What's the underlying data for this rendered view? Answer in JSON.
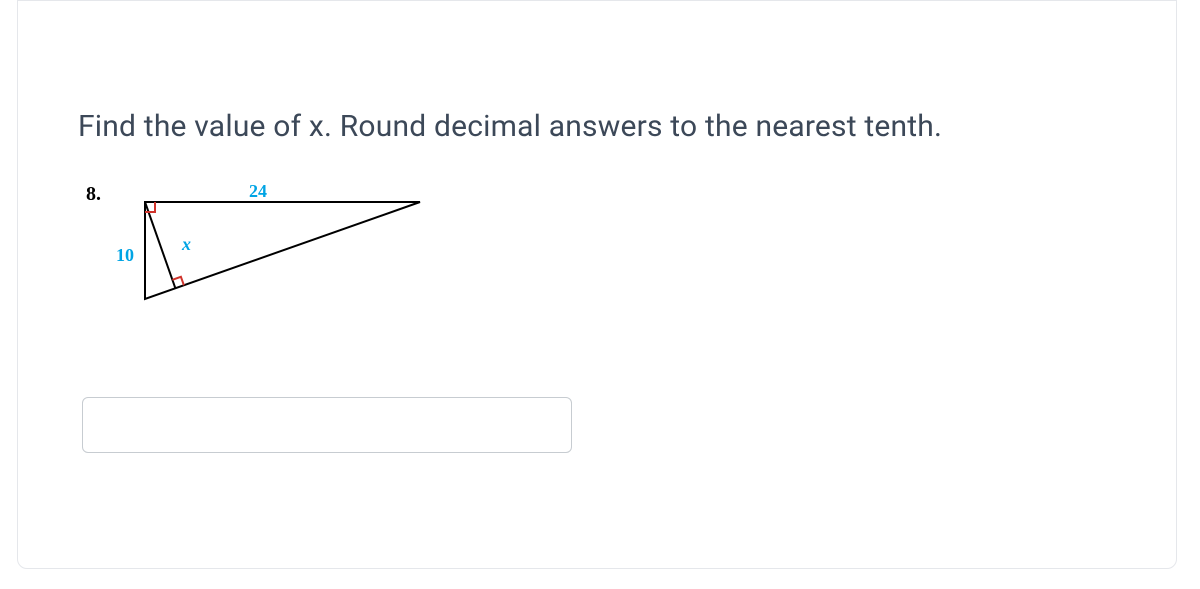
{
  "question": {
    "prompt": "Find the value of x. Round decimal answers to the nearest tenth.",
    "number_label": "8.",
    "figure": {
      "top_side_label": "24",
      "left_side_label": "10",
      "altitude_label": "x"
    },
    "answer_value": ""
  }
}
